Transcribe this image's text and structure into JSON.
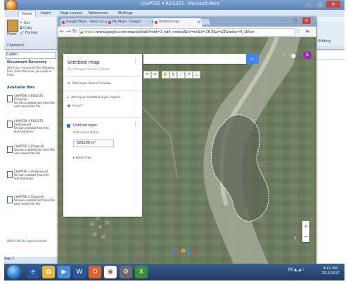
{
  "word": {
    "title": "CHAPTER 4 RESULTS - Microsoft Word",
    "tabs": [
      "Home",
      "Insert",
      "Page Layout",
      "References",
      "Mailings"
    ],
    "clipboard_label": "Clipboard",
    "paste_label": "Paste",
    "style_value": "Calibri"
  },
  "left_pane": {
    "select_value": "Calibri",
    "heading_1": "Document Recovery",
    "note": "Word has recovered the following files. Save the ones you wish to keep.",
    "heading_2": "Available files",
    "items": [
      {
        "title": "CHAPTER 4 RESULTS [Original]",
        "sub": "Version created last time the user saved the file"
      },
      {
        "title": "CHAPTER 4 RESULTS [Autosaved]",
        "sub": "Version created from the last AutoSave"
      },
      {
        "title": "CHAPTER 3 [Original]",
        "sub": "Version created last time the user saved the file"
      },
      {
        "title": "CHAPTER 3 [Autosaved]",
        "sub": "Version created from the last AutoSave"
      },
      {
        "title": "CHAPTER 2 [Original]",
        "sub": "Version created last time the user saved the file"
      }
    ],
    "footer": "Which file do I want to save?",
    "status": "Page: 1"
  },
  "browser": {
    "tabs": [
      {
        "label": "Google Maps - Area calc",
        "active": false
      },
      {
        "label": "My Maps - Google",
        "active": false
      },
      {
        "label": "Untitled map",
        "active": true
      }
    ],
    "url_scheme": "https://",
    "url_rest": "www.google.com/maps/d/edit?mid=1_edit_embed&hl=en&ll=26.5&z=15&iwloc=A_Other"
  },
  "map_panel": {
    "title": "Untitled map",
    "subtitle": "All changes saved in Drive",
    "action_row": "Add layer   Share   Preview",
    "layer1_row": "Add layer   Untitled layer  Import",
    "layer1_link": "Import",
    "layer2_title": "Untitled layer",
    "layer2_link": "Individual styles",
    "area_value": "526209 m²",
    "base_map": "Base map"
  },
  "map": {
    "google_logo": "Google",
    "help": "?",
    "avatar_letter": "A",
    "zoom_in": "+",
    "zoom_out": "−"
  },
  "taskbar": {
    "tray": "EN  ▲  ◢  ♪",
    "time": "9:41 AM",
    "date": "7/12/2017"
  },
  "colors": {
    "accent": "#1a73e8",
    "search_button": "#4285f4",
    "avatar": "#9c27b0"
  }
}
